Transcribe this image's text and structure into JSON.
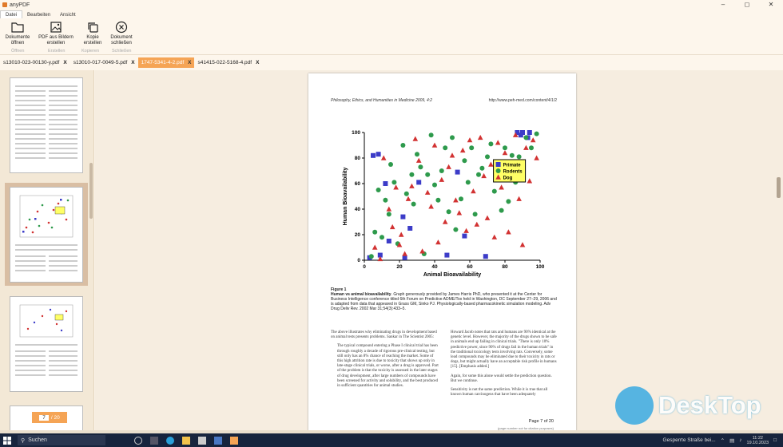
{
  "window": {
    "title": "anyPDF"
  },
  "menu_tabs": [
    "Datei",
    "Bearbeiten",
    "Ansicht"
  ],
  "ribbon": {
    "buttons": [
      {
        "label": "Dokumente\nöffnen",
        "icon": "folder-icon"
      },
      {
        "label": "PDF aus Bildern\nerstellen",
        "icon": "image-icon"
      },
      {
        "label": "Kopie\nerstellen",
        "icon": "copy-icon"
      },
      {
        "label": "Dokument\nschließen",
        "icon": "close-circle-icon"
      }
    ],
    "groups": [
      "Öffnen",
      "Erstellen",
      "Kopieren",
      "Schließen"
    ]
  },
  "doc_tabs": [
    {
      "name": "s13010-023-00130-y.pdf",
      "active": false
    },
    {
      "name": "s13010-017-0049-5.pdf",
      "active": false
    },
    {
      "name": "1747-5341-4-2.pdf",
      "active": true
    },
    {
      "name": "s41415-022-5168-4.pdf",
      "active": false
    }
  ],
  "close_glyph": "X",
  "page_nav": {
    "current": "7",
    "total": "/ 20"
  },
  "document": {
    "header_left": "Philosophy, Ethics, and Humanities in Medicine 2009, 4:2",
    "header_right": "http://www.peh-med.com/content/4/1/2",
    "figure_caption_title": "Figure 1",
    "figure_caption_bold": "Human vs animal bioavailability",
    "figure_caption_text": ". Graph generously provided by James Harris PhD, who presented it at the Center for Business Intelligence conference titled 6th Forum on Predictive ADME/Tox held in Washington, DC September 27–29, 2006 and is adapted from data that appeared in Grass GM, Sinko PJ. Physiologically-based pharmacokinetic simulation modeling. Adv Drug Deliv Rev. 2002 Mar 31;54(3):433–5.",
    "col1_p1": "The above illustrates why eliminating drugs in development based on animal tests presents problems. Sankar in The Scientist 2005:",
    "col1_p2": "The typical compound entering a Phase I clinical trial has been through roughly a decade of rigorous pre-clinical testing, but still only has an 8% chance of reaching the market. Some of this high attrition rate is due to toxicity that shows up only in late-stage clinical trials, or worse, after a drug is approved. Part of the problem is that the toxicity is assessed in the later stages of drug development, after large numbers of compounds have been screened for activity and solubility, and the best produced in sufficient quantities for animal studies.",
    "col2_p1": "Howard Jacob notes that rats and humans are 90% identical at the genetic level. However, the majority of the drugs shown to be safe in animals end up failing in clinical trials. \"There is only 10% predictive power, since 90% of drugs fail in the human trials\" in the traditional toxicology tests involving rats. Conversely, some lead compounds may be eliminated due to their toxicity in rats or dogs, but might actually have an acceptable risk profile in humans [15]. [Emphasis added.]",
    "col2_p2": "Again, for some this alone would settle the prediction question. But we continue.",
    "col2_p3": "Sensitivity is not the same prediction. While it is true that all known human carcinogens that have been adequately",
    "page_label": "Page 7 of 20",
    "page_note": "(page number not for citation purposes)"
  },
  "taskbar": {
    "search_label": "Suchen",
    "news_text": "Gesperrte Straße bei...",
    "time": "11:22",
    "date": "19.10.2023"
  },
  "watermark": {
    "text": "DeskTop"
  },
  "chart_data": {
    "type": "scatter",
    "xlabel": "Animal Bioavailability",
    "ylabel": "Human Bioavailability",
    "xlim": [
      0,
      100
    ],
    "ylim": [
      0,
      100
    ],
    "xticks": [
      0,
      20,
      40,
      60,
      80,
      100
    ],
    "yticks": [
      0,
      20,
      40,
      60,
      80,
      100
    ],
    "legend_position": "upper-right",
    "series": [
      {
        "name": "Primate",
        "marker": "square",
        "color": "#3c3cc8",
        "x": [
          3,
          5,
          8,
          9,
          12,
          14,
          22,
          23,
          26,
          31,
          47,
          53,
          57,
          69,
          87,
          89,
          90,
          93,
          94
        ],
        "y": [
          2,
          82,
          83,
          4,
          60,
          15,
          34,
          2,
          25,
          61,
          4,
          69,
          19,
          3,
          100,
          98,
          100,
          96,
          100
        ]
      },
      {
        "name": "Rodents",
        "marker": "circle",
        "color": "#2e9a4c",
        "x": [
          4,
          6,
          8,
          10,
          12,
          14,
          15,
          17,
          19,
          22,
          24,
          27,
          28,
          30,
          32,
          34,
          36,
          38,
          40,
          42,
          44,
          46,
          48,
          50,
          52,
          55,
          57,
          59,
          61,
          63,
          65,
          67,
          70,
          72,
          74,
          76,
          78,
          80,
          82,
          84,
          86,
          88,
          90,
          92,
          95,
          98
        ],
        "y": [
          3,
          22,
          55,
          18,
          47,
          36,
          75,
          61,
          13,
          90,
          52,
          67,
          44,
          83,
          73,
          5,
          67,
          98,
          59,
          47,
          70,
          88,
          38,
          96,
          24,
          48,
          78,
          61,
          88,
          36,
          67,
          72,
          81,
          91,
          54,
          69,
          39,
          88,
          46,
          82,
          61,
          81,
          72,
          96,
          88,
          99
        ]
      },
      {
        "name": "Dog",
        "marker": "triangle",
        "color": "#d23232",
        "x": [
          6,
          9,
          11,
          14,
          16,
          18,
          20,
          21,
          23,
          25,
          27,
          29,
          31,
          33,
          36,
          38,
          40,
          42,
          44,
          46,
          48,
          50,
          52,
          54,
          56,
          58,
          60,
          62,
          64,
          66,
          68,
          70,
          72,
          74,
          76,
          78,
          80,
          82,
          84,
          86,
          88,
          90,
          92,
          94,
          96,
          98
        ],
        "y": [
          10,
          1,
          80,
          40,
          26,
          57,
          12,
          20,
          5,
          48,
          58,
          95,
          78,
          7,
          53,
          42,
          90,
          14,
          63,
          30,
          73,
          82,
          47,
          37,
          86,
          23,
          94,
          54,
          28,
          96,
          66,
          33,
          75,
          18,
          92,
          57,
          84,
          22,
          71,
          98,
          48,
          12,
          88,
          62,
          94,
          80
        ]
      }
    ]
  }
}
